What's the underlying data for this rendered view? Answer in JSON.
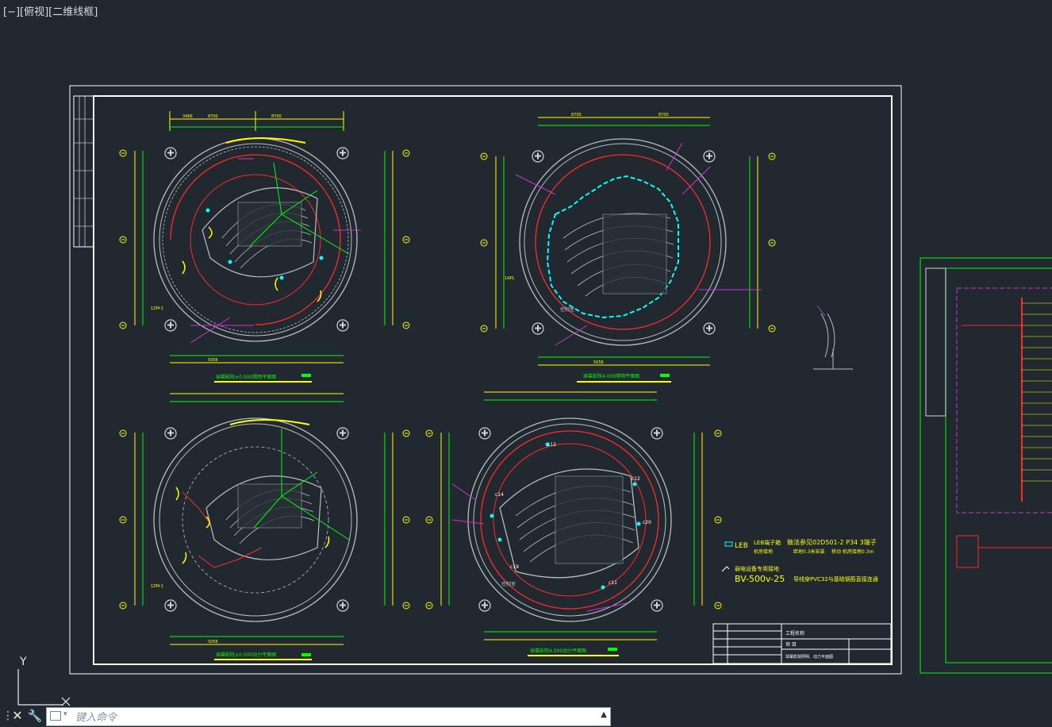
{
  "viewport": {
    "label": "[−][俯视][二维线框]"
  },
  "colors": {
    "background": "#212830",
    "frame": "#ffffff",
    "red": "#ff2a2a",
    "green": "#00ff00",
    "yellow": "#ffff00",
    "cyan": "#00ffff",
    "magenta": "#cc33cc",
    "gray": "#b9bec4"
  },
  "plans": {
    "top_left_title": "球幕影院±0.000照明平面图",
    "top_right_title": "球幕影院4.000照明平面图",
    "bottom_left_title": "球幕影院±0.000动力平面图",
    "bottom_right_title": "球幕影院4.000动力平面图",
    "dim_3466": "3466",
    "dim_5056": "5056",
    "dim_8700": "8700",
    "dim_3700": "3700",
    "dim_5000": "5000",
    "callouts": {
      "box_1": "1ZM-1",
      "box_2": "1APL",
      "c12": "c12",
      "c13": "c13",
      "c14": "c14",
      "c19": "c19",
      "c20": "c20",
      "c11": "c11",
      "ctrl_room": "控制室"
    }
  },
  "legend": {
    "leb_symbol": "LEB",
    "leb_text": "LEB端子箱",
    "leb_install": "做法参见02D501-2 P34 3端子",
    "leb_note_1": "机房接地",
    "leb_note_2": "距地0.3米安装",
    "leb_note_3": "移动 机房接地0.3m",
    "conduit_label": "弱电设备专用接地",
    "conduit_spec": "BV-500v-25",
    "conduit_suffix": "导线穿PVC32与基础钢筋直接连通"
  },
  "title_block": {
    "project_name_label": "工程名称",
    "item_label": "项 目",
    "drawing_name": "球幕影院照明、动力平面图"
  },
  "command_line": {
    "placeholder": "键入命令"
  },
  "ucs": {
    "y_label": "Y",
    "x_label": "X"
  }
}
